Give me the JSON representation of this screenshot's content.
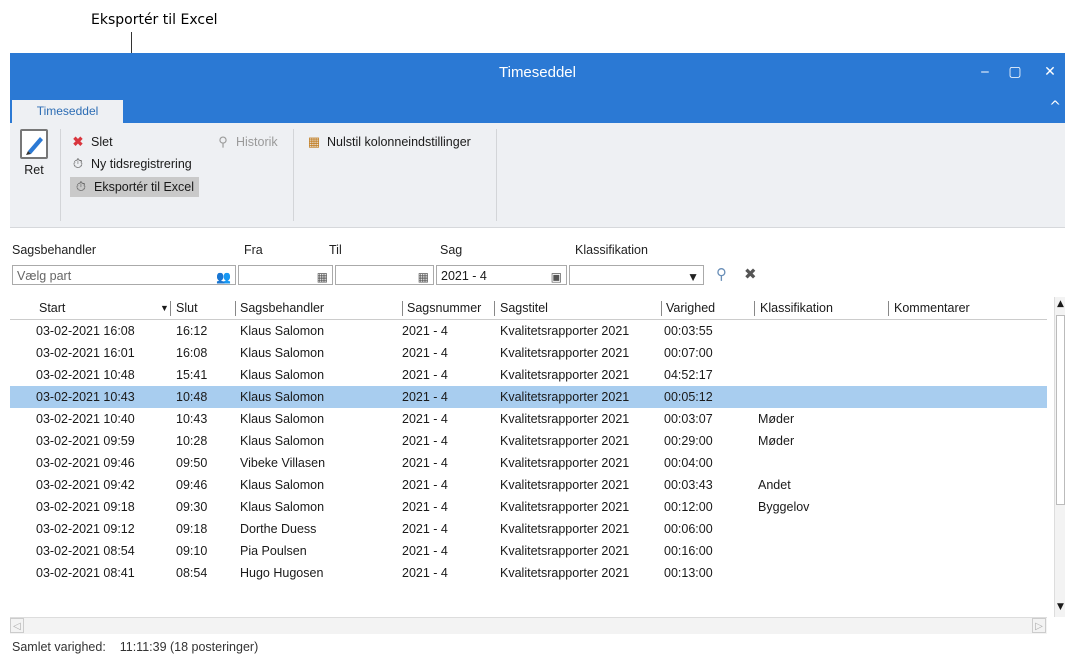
{
  "annotation": {
    "label": "Eksportér til Excel"
  },
  "window": {
    "title": "Timeseddel",
    "minimize": "‒",
    "maximize": "▢",
    "close": "✕"
  },
  "ribbon_tab": {
    "label": "Timeseddel",
    "collapse": "^"
  },
  "ribbon": {
    "ret": "Ret",
    "slet": "Slet",
    "ny": "Ny tidsregistrering",
    "eksporter": "Eksportér til Excel",
    "historik": "Historik",
    "nulstil": "Nulstil kolonneindstillinger"
  },
  "filters": {
    "sagsbehandler_label": "Sagsbehandler",
    "sagsbehandler_placeholder": "Vælg part",
    "fra_label": "Fra",
    "til_label": "Til",
    "sag_label": "Sag",
    "sag_value": "2021 - 4",
    "klassifikation_label": "Klassifikation",
    "fra_value": "",
    "til_value": "",
    "klassifikation_value": ""
  },
  "columns": [
    "Start",
    "Slut",
    "Sagsbehandler",
    "Sagsnummer",
    "Sagstitel",
    "Varighed",
    "Klassifikation",
    "Kommentarer"
  ],
  "rows": [
    {
      "start": "03-02-2021 16:08",
      "slut": "16:12",
      "behandler": "Klaus Salomon",
      "nr": "2021 - 4",
      "titel": "Kvalitetsrapporter 2021",
      "varighed": "00:03:55",
      "klass": ""
    },
    {
      "start": "03-02-2021 16:01",
      "slut": "16:08",
      "behandler": "Klaus Salomon",
      "nr": "2021 - 4",
      "titel": "Kvalitetsrapporter 2021",
      "varighed": "00:07:00",
      "klass": ""
    },
    {
      "start": "03-02-2021 10:48",
      "slut": "15:41",
      "behandler": "Klaus Salomon",
      "nr": "2021 - 4",
      "titel": "Kvalitetsrapporter 2021",
      "varighed": "04:52:17",
      "klass": ""
    },
    {
      "start": "03-02-2021 10:43",
      "slut": "10:48",
      "behandler": "Klaus Salomon",
      "nr": "2021 - 4",
      "titel": "Kvalitetsrapporter 2021",
      "varighed": "00:05:12",
      "klass": ""
    },
    {
      "start": "03-02-2021 10:40",
      "slut": "10:43",
      "behandler": "Klaus Salomon",
      "nr": "2021 - 4",
      "titel": "Kvalitetsrapporter 2021",
      "varighed": "00:03:07",
      "klass": "Møder"
    },
    {
      "start": "03-02-2021 09:59",
      "slut": "10:28",
      "behandler": "Klaus Salomon",
      "nr": "2021 - 4",
      "titel": "Kvalitetsrapporter 2021",
      "varighed": "00:29:00",
      "klass": "Møder"
    },
    {
      "start": "03-02-2021 09:46",
      "slut": "09:50",
      "behandler": "Vibeke Villasen",
      "nr": "2021 - 4",
      "titel": "Kvalitetsrapporter 2021",
      "varighed": "00:04:00",
      "klass": ""
    },
    {
      "start": "03-02-2021 09:42",
      "slut": "09:46",
      "behandler": "Klaus Salomon",
      "nr": "2021 - 4",
      "titel": "Kvalitetsrapporter 2021",
      "varighed": "00:03:43",
      "klass": "Andet"
    },
    {
      "start": "03-02-2021 09:18",
      "slut": "09:30",
      "behandler": "Klaus Salomon",
      "nr": "2021 - 4",
      "titel": "Kvalitetsrapporter 2021",
      "varighed": "00:12:00",
      "klass": "Byggelov"
    },
    {
      "start": "03-02-2021 09:12",
      "slut": "09:18",
      "behandler": "Dorthe Duess",
      "nr": "2021 - 4",
      "titel": "Kvalitetsrapporter 2021",
      "varighed": "00:06:00",
      "klass": ""
    },
    {
      "start": "03-02-2021 08:54",
      "slut": "09:10",
      "behandler": "Pia Poulsen",
      "nr": "2021 - 4",
      "titel": "Kvalitetsrapporter 2021",
      "varighed": "00:16:00",
      "klass": ""
    },
    {
      "start": "03-02-2021 08:41",
      "slut": "08:54",
      "behandler": "Hugo Hugosen",
      "nr": "2021 - 4",
      "titel": "Kvalitetsrapporter 2021",
      "varighed": "00:13:00",
      "klass": ""
    }
  ],
  "selected_row": 3,
  "status": {
    "label": "Samlet varighed:",
    "value": "11:11:39 (18 posteringer)"
  },
  "colors": {
    "accent": "#2b79d4",
    "selection": "#a8cdef",
    "delete": "#d9363e"
  }
}
